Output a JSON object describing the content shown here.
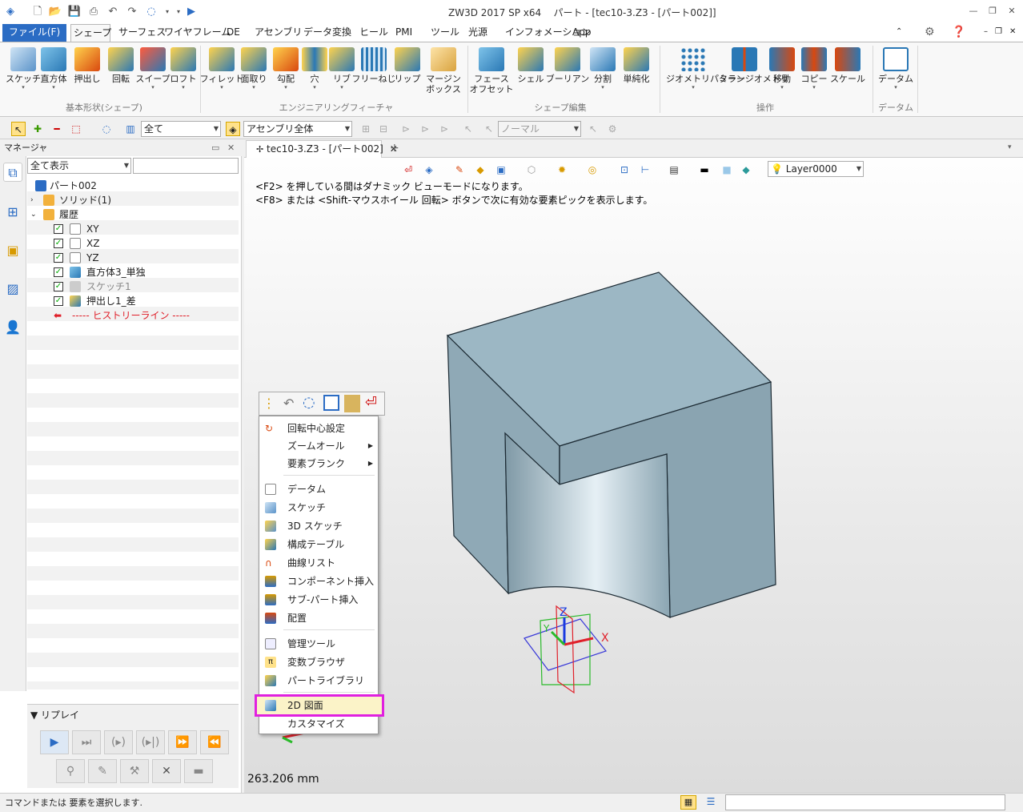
{
  "app": {
    "title": "ZW3D 2017 SP x64",
    "doc_title": "パート - [tec10-3.Z3 - [パート002]]"
  },
  "ribbon_tabs": [
    "ファイル(F)",
    "シェープ",
    "サーフェス",
    "ワイヤフレーム",
    "DE",
    "アセンブリ",
    "データ変換",
    "ヒール",
    "PMI",
    "ツール",
    "光源",
    "インフォメーション",
    "App"
  ],
  "ribbon": {
    "groups": [
      "基本形状(シェープ)",
      "エンジニアリングフィーチャ",
      "シェープ編集",
      "操作",
      "データム"
    ],
    "buttons": [
      "スケッチ",
      "直方体",
      "押出し",
      "回転",
      "スイープ",
      "ロフト",
      "フィレット",
      "面取り",
      "勾配",
      "穴",
      "リブ",
      "フリーねじ",
      "リップ",
      "マージン",
      "ボックス",
      "フェース",
      "オフセット",
      "シェル",
      "ブーリアン",
      "分割",
      "単純化",
      "ジオメトリパターン",
      "ミラージオメトリ",
      "移動",
      "コピー",
      "スケール",
      "データム"
    ]
  },
  "toolbar2": {
    "filter_value": "全て",
    "scope_value": "アセンブリ全体",
    "mode_placeholder": "ノーマル"
  },
  "manager": {
    "title": "マネージャ",
    "filter_value": "全て表示",
    "tree": [
      {
        "label": "パート002"
      },
      {
        "label": "ソリッド(1)"
      },
      {
        "label": "履歴"
      },
      {
        "label": "XY"
      },
      {
        "label": "XZ"
      },
      {
        "label": "YZ"
      },
      {
        "label": "直方体3_単独"
      },
      {
        "label": "スケッチ1"
      },
      {
        "label": "押出し1_差"
      },
      {
        "label": "----- ヒストリーライン -----"
      }
    ],
    "replay_title": "リプレイ"
  },
  "viewport": {
    "tab_label": "tec10-3.Z3 - [パート002]",
    "layer_value": "Layer0000",
    "hint1": "<F2> を押している間はダナミック ビューモードになります。",
    "hint2": "<F8> または <Shift-マウスホイール 回転> ボタンで次に有効な要素ピックを表示します。",
    "measure": "263.206 mm",
    "axis_x": "X",
    "axis_y": "Y",
    "axis_z": "Z"
  },
  "context_menu": {
    "items": [
      {
        "label": "回転中心設定"
      },
      {
        "label": "ズームオール"
      },
      {
        "label": "要素ブランク"
      },
      {
        "label": "データム"
      },
      {
        "label": "スケッチ"
      },
      {
        "label": "3D スケッチ"
      },
      {
        "label": "構成テーブル"
      },
      {
        "label": "曲線リスト"
      },
      {
        "label": "コンポーネント挿入"
      },
      {
        "label": "サブ-パート挿入"
      },
      {
        "label": "配置"
      },
      {
        "label": "管理ツール"
      },
      {
        "label": "変数ブラウザ"
      },
      {
        "label": "パートライブラリ"
      },
      {
        "label": "2D 図面"
      },
      {
        "label": "カスタマイズ"
      }
    ]
  },
  "status": {
    "text": "コマンドまたは 要素を選択します."
  },
  "colors": {
    "accent": "#2b6cc4",
    "highlight_outline": "#e020e0",
    "solid_face": "#8fa9b6"
  }
}
